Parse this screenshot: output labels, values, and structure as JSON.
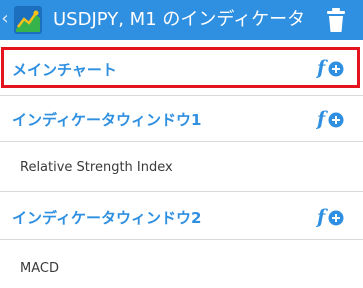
{
  "header": {
    "title": "USDJPY, M1 のインディケータ",
    "back_icon": "chevron-left-icon",
    "logo_icon": "app-logo-icon",
    "delete_icon": "trash-icon"
  },
  "sections": [
    {
      "label": "メインチャート",
      "add_icon": "add-indicator-icon",
      "selected": true,
      "items": []
    },
    {
      "label": "インディケータウィンドウ1",
      "add_icon": "add-indicator-icon",
      "selected": false,
      "items": [
        "Relative Strength Index"
      ]
    },
    {
      "label": "インディケータウィンドウ2",
      "add_icon": "add-indicator-icon",
      "selected": false,
      "items": [
        "MACD"
      ]
    }
  ],
  "colors": {
    "accent": "#2f8fe0",
    "selection_border": "#e3141d",
    "divider": "#d9d9d9"
  }
}
